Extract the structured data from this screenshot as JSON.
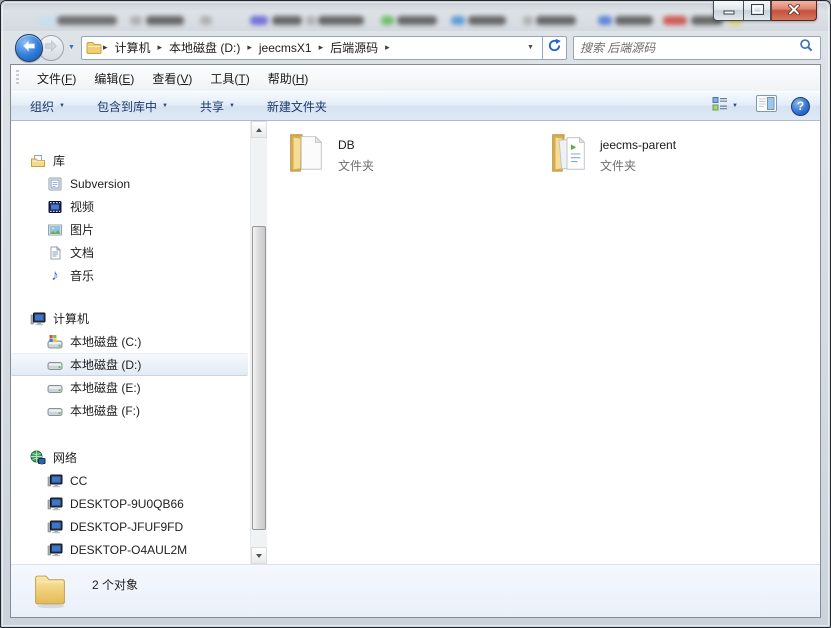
{
  "glyphs": {
    "caret_down": "▼",
    "crumb_separator": "▸",
    "help": "?",
    "music_note": "♪"
  },
  "colors": {
    "accent_blue": "#2f7bd9",
    "toolbar_text": "#1c3a6e",
    "folder_gold": "#f0d078",
    "close_red": "#c4513c"
  },
  "address_bar": {
    "crumbs": [
      "计算机",
      "本地磁盘 (D:)",
      "jeecmsX1",
      "后端源码"
    ]
  },
  "search": {
    "placeholder": "搜索 后端源码"
  },
  "menu_bar": {
    "items": [
      {
        "pre": "文件(",
        "key": "F",
        "post": ")"
      },
      {
        "pre": "编辑(",
        "key": "E",
        "post": ")"
      },
      {
        "pre": "查看(",
        "key": "V",
        "post": ")"
      },
      {
        "pre": "工具(",
        "key": "T",
        "post": ")"
      },
      {
        "pre": "帮助(",
        "key": "H",
        "post": ")"
      }
    ]
  },
  "toolbar": {
    "organize": "组织",
    "include_in_library": "包含到库中",
    "share": "共享",
    "new_folder": "新建文件夹"
  },
  "sidebar": {
    "sections": [
      {
        "label": "库",
        "children": [
          {
            "label": "Subversion"
          },
          {
            "label": "视频"
          },
          {
            "label": "图片"
          },
          {
            "label": "文档"
          },
          {
            "label": "音乐"
          }
        ]
      },
      {
        "label": "计算机",
        "children": [
          {
            "label": "本地磁盘 (C:)"
          },
          {
            "label": "本地磁盘 (D:)",
            "selected": true
          },
          {
            "label": "本地磁盘 (E:)"
          },
          {
            "label": "本地磁盘 (F:)"
          }
        ]
      },
      {
        "label": "网络",
        "children": [
          {
            "label": "CC"
          },
          {
            "label": "DESKTOP-9U0QB66"
          },
          {
            "label": "DESKTOP-JFUF9FD"
          },
          {
            "label": "DESKTOP-O4AUL2M"
          }
        ]
      }
    ]
  },
  "files": {
    "items": [
      {
        "name": "DB",
        "type": "文件夹"
      },
      {
        "name": "jeecms-parent",
        "type": "文件夹"
      }
    ]
  },
  "status_bar": {
    "text": "2 个对象"
  }
}
